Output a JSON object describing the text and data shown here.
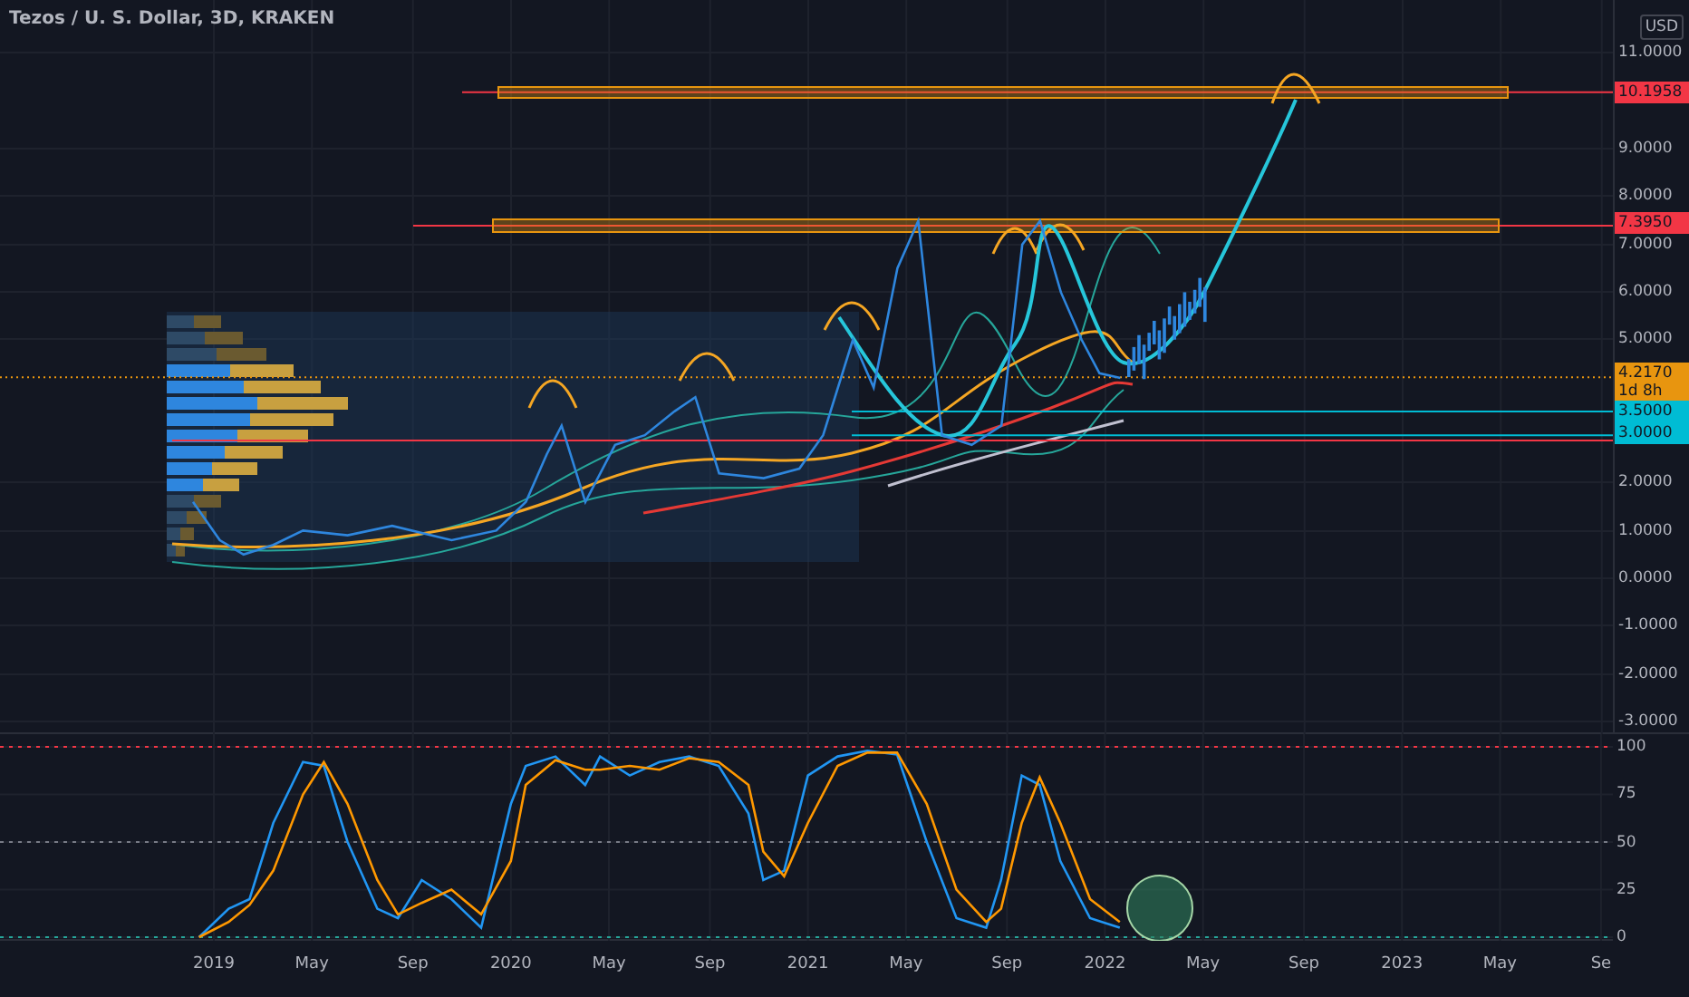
{
  "title": "Tezos / U. S. Dollar, 3D, KRAKEN",
  "price_pane": {
    "currency": "USD",
    "axis_labels": [
      "11.0000",
      "9.0000",
      "8.0000",
      "7.0000",
      "6.0000",
      "5.0000",
      "2.0000",
      "1.0000",
      "0.0000",
      "-1.0000",
      "-2.0000",
      "-3.0000"
    ],
    "price_tags": [
      {
        "label": "10.1958",
        "color": "#f23645"
      },
      {
        "label": "7.3950",
        "color": "#f23645"
      },
      {
        "label": "4.2170",
        "sublabel": "1d 8h",
        "color": "#e8950f"
      },
      {
        "label": "3.5000",
        "color": "#00bcd4"
      },
      {
        "label": "3.0000",
        "color": "#00bcd4"
      }
    ]
  },
  "oscillator_pane": {
    "chart_data": {
      "type": "line",
      "x": [
        2018.95,
        2019.05,
        2019.12,
        2019.2,
        2019.3,
        2019.37,
        2019.45,
        2019.55,
        2019.62,
        2019.7,
        2019.8,
        2019.9,
        2020,
        2020.05,
        2020.15,
        2020.25,
        2020.3,
        2020.4,
        2020.5,
        2020.6,
        2020.7,
        2020.8,
        2020.85,
        2020.92,
        2021,
        2021.1,
        2021.2,
        2021.3,
        2021.4,
        2021.5,
        2021.6,
        2021.65,
        2021.72,
        2021.78,
        2021.85,
        2021.95,
        2022.05
      ],
      "series": [
        {
          "color": "#2196f3",
          "values": [
            0,
            15,
            20,
            60,
            92,
            90,
            50,
            15,
            10,
            30,
            20,
            5,
            70,
            90,
            95,
            80,
            95,
            85,
            92,
            95,
            90,
            65,
            30,
            35,
            85,
            95,
            98,
            96,
            50,
            10,
            5,
            30,
            85,
            80,
            40,
            10,
            5
          ]
        },
        {
          "color": "#ff9800",
          "values": [
            0,
            8,
            17,
            35,
            75,
            92,
            70,
            30,
            12,
            18,
            25,
            12,
            40,
            80,
            93,
            88,
            88,
            90,
            88,
            94,
            92,
            80,
            45,
            32,
            60,
            90,
            97,
            97,
            70,
            25,
            8,
            15,
            60,
            84,
            60,
            20,
            8
          ]
        }
      ],
      "xlim": [
        2018.28,
        2023.71
      ],
      "ylim": [
        -1.9,
        106.7
      ],
      "grid": true,
      "xticks": [
        {
          "value": 2019,
          "label": "2019"
        },
        {
          "value": 2019.33,
          "label": "May"
        },
        {
          "value": 2019.67,
          "label": "Sep"
        },
        {
          "value": 2020,
          "label": "2020"
        },
        {
          "value": 2020.33,
          "label": "May"
        },
        {
          "value": 2020.67,
          "label": "Sep"
        },
        {
          "value": 2021,
          "label": "2021"
        },
        {
          "value": 2021.33,
          "label": "May"
        },
        {
          "value": 2021.67,
          "label": "Sep"
        },
        {
          "value": 2022,
          "label": "2022"
        },
        {
          "value": 2022.33,
          "label": "May"
        },
        {
          "value": 2022.67,
          "label": "Sep"
        },
        {
          "value": 2023,
          "label": "2023"
        },
        {
          "value": 2023.33,
          "label": "May"
        },
        {
          "value": 2023.67,
          "label": "Se"
        }
      ],
      "yticks": [
        {
          "value": 100,
          "label": "100"
        },
        {
          "value": 75,
          "label": "75"
        },
        {
          "value": 50,
          "label": "50"
        },
        {
          "value": 25,
          "label": "25"
        },
        {
          "value": 0,
          "label": "0"
        }
      ],
      "ref_lines": [
        {
          "axis": "y",
          "value": 100,
          "color": "#f23645"
        },
        {
          "axis": "y",
          "value": 50,
          "color": "#787b86"
        },
        {
          "axis": "y",
          "value": 0,
          "color": "#26a69a"
        }
      ]
    }
  }
}
